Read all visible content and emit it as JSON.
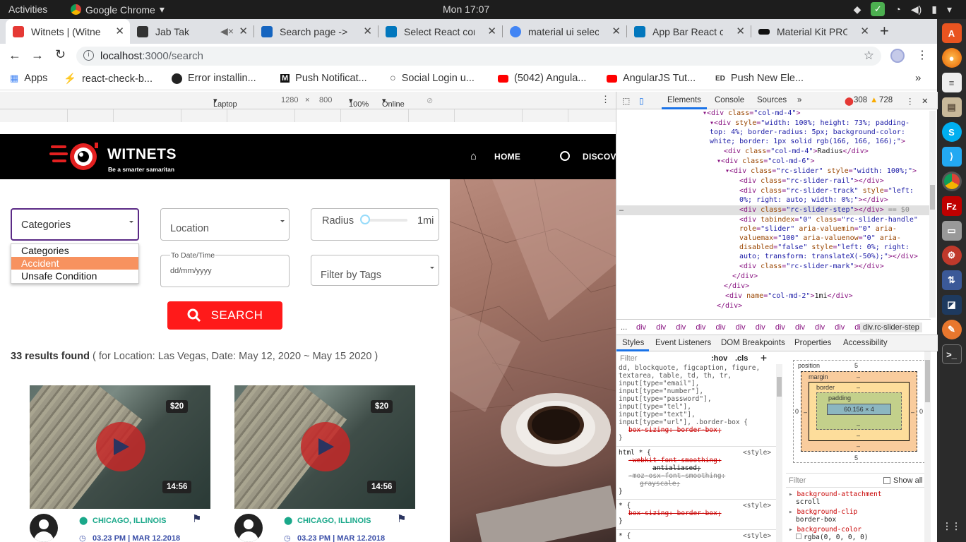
{
  "topbar": {
    "activities": "Activities",
    "app_name": "Google Chrome",
    "clock": "Mon 17:07"
  },
  "tabs": [
    {
      "title": "Witnets | (Witne",
      "color": "#e53935"
    },
    {
      "title": "Jab Tak",
      "color": "#333333"
    },
    {
      "title": "Search page -> o",
      "color": "#1565c0"
    },
    {
      "title": "Select React com",
      "color": "#0277bd"
    },
    {
      "title": "material ui selec",
      "color": "#4285f4"
    },
    {
      "title": "App Bar React co",
      "color": "#0277bd"
    },
    {
      "title": "Material Kit PRO",
      "color": "#111111"
    }
  ],
  "address": {
    "host": "localhost",
    "path": ":3000/search"
  },
  "bookmarks": [
    {
      "label": "Apps",
      "color": "#4285f4"
    },
    {
      "label": "react-check-b...",
      "color": "#1a73e8"
    },
    {
      "label": "Error installin...",
      "color": "#222222"
    },
    {
      "label": "Push Notificat...",
      "color": "#111111"
    },
    {
      "label": "Social Login u...",
      "color": "#555555"
    },
    {
      "label": "(5042) Angula...",
      "color": "#ff0000"
    },
    {
      "label": "AngularJS Tut...",
      "color": "#ff0000"
    },
    {
      "label": "Push New Ele...",
      "color": "#333333"
    }
  ],
  "device_toolbar": {
    "device": "Laptop wit...",
    "width": "1280",
    "x": "×",
    "height": "800",
    "zoom": "100%",
    "network": "Online"
  },
  "site": {
    "logo_title": "WITNETS",
    "logo_sub": "Be a smarter samaritan",
    "nav": [
      "HOME",
      "DISCOVE"
    ],
    "filters": {
      "category_value": "Categories",
      "location_placeholder": "Location",
      "radius_label": "Radius",
      "radius_value": "1mi",
      "date_label": "To Date/Time",
      "date_placeholder": "dd/mm/yyyy",
      "tags_placeholder": "Filter by Tags"
    },
    "category_options": [
      "Categories",
      "Accident",
      "Unsafe Condition"
    ],
    "selected_option": "Accident",
    "search_label": "SEARCH",
    "results_count": "33 results found",
    "results_detail": "( for Location: Las Vegas, Date: May 12, 2020 ~ May 15 2020 )",
    "cards": [
      {
        "price": "$20",
        "duration": "14:56",
        "location": "CHICAGO, ILLINOIS",
        "datetime": "03.23 PM | MAR 12.2018"
      },
      {
        "price": "$20",
        "duration": "14:56",
        "location": "CHICAGO, ILLINOIS",
        "datetime": "03.23 PM | MAR 12.2018"
      }
    ]
  },
  "devtools": {
    "tabs": [
      "Elements",
      "Console",
      "Sources"
    ],
    "errors": "308",
    "warnings": "728",
    "selected_node": "div.rc-slider-step",
    "lower_tabs": [
      "Styles",
      "Event Listeners",
      "DOM Breakpoints",
      "Properties",
      "Accessibility"
    ],
    "filter_placeholder": "Filter",
    "hov": ":hov",
    "cls": ".cls",
    "box_model": {
      "position": "position",
      "position_val": "5",
      "margin": "margin",
      "border": "border",
      "padding": "padding",
      "content": "60.156 × 4",
      "dash": "–",
      "zero": "0",
      "bottom_val": "5"
    },
    "computed_filter": "Filter",
    "show_all": "Show all",
    "computed": [
      {
        "prop": "background-attachment",
        "val": "scroll"
      },
      {
        "prop": "background-clip",
        "val": "border-box"
      },
      {
        "prop": "background-color",
        "val": "rgba(0, 0, 0, 0)"
      }
    ]
  }
}
